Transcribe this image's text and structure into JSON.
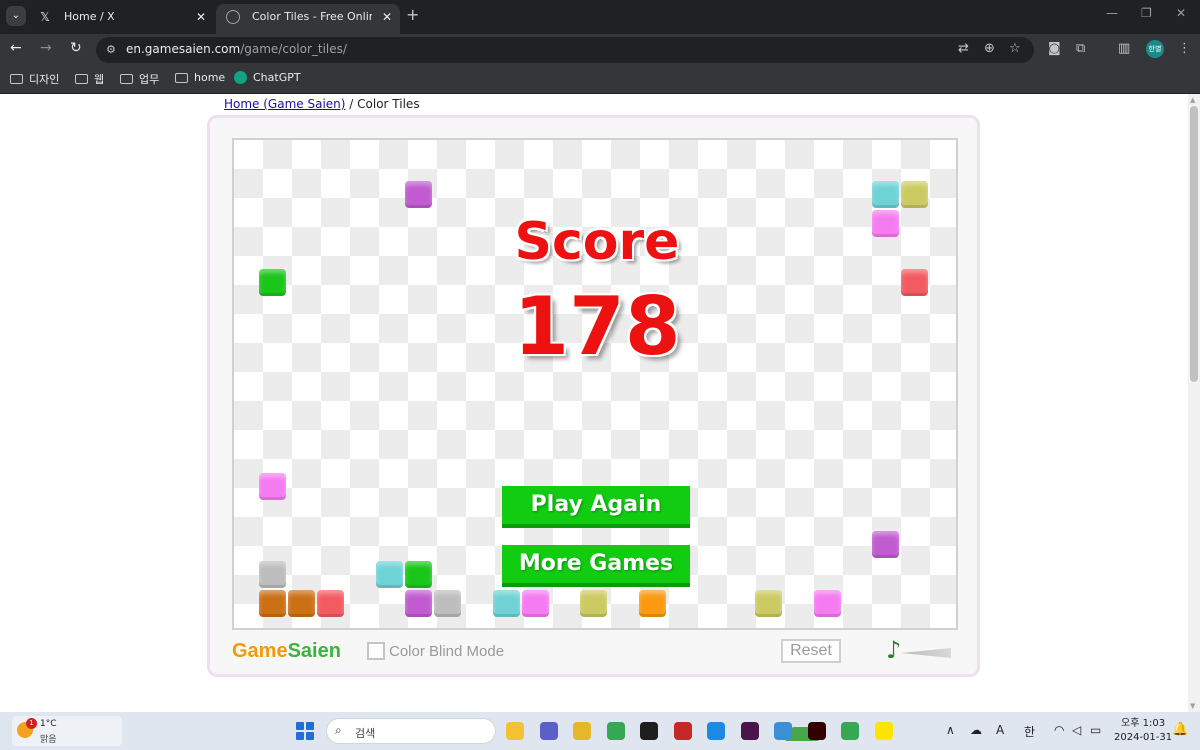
{
  "browser": {
    "tabs": [
      {
        "title": "Home / X",
        "icon": "x-logo-icon",
        "active": false
      },
      {
        "title": "Color Tiles - Free Online Puzzle",
        "icon": "globe-icon",
        "active": true
      }
    ],
    "address": {
      "domain": "en.gamesaien.com",
      "path": "/game/color_tiles/"
    },
    "bookmarks": [
      {
        "label": "디자인",
        "icon": "folder-icon"
      },
      {
        "label": "웹",
        "icon": "folder-icon"
      },
      {
        "label": "업무",
        "icon": "folder-icon"
      },
      {
        "label": "home",
        "icon": "folder-icon"
      },
      {
        "label": "ChatGPT",
        "icon": "chatgpt-icon"
      }
    ],
    "profile_label": "한별"
  },
  "page": {
    "breadcrumb": {
      "home_link": "Home (Game Saien)",
      "separator": "/",
      "current": "Color Tiles"
    },
    "game": {
      "score_label": "Score",
      "score_value": "178",
      "buttons": {
        "play_again": "Play Again",
        "more_games": "More Games"
      },
      "logo": {
        "part1": "Game",
        "part2": "Saien"
      },
      "color_blind_label": "Color Blind Mode",
      "reset_label": "Reset",
      "colors": {
        "purple": "#c05cd0",
        "cyan": "#6fd3d6",
        "olive": "#cccb63",
        "pink": "#f57cf0",
        "green": "#1bc61b",
        "red": "#f25c60",
        "gray": "#bdbdbd",
        "orange": "#fb9a10",
        "brown": "#cb7014"
      },
      "tiles": [
        {
          "col": 6,
          "row": 1,
          "color": "purple"
        },
        {
          "col": 22,
          "row": 1,
          "color": "cyan"
        },
        {
          "col": 23,
          "row": 1,
          "color": "olive"
        },
        {
          "col": 22,
          "row": 2,
          "color": "pink"
        },
        {
          "col": 1,
          "row": 4,
          "color": "green"
        },
        {
          "col": 23,
          "row": 4,
          "color": "red"
        },
        {
          "col": 1,
          "row": 11,
          "color": "pink"
        },
        {
          "col": 22,
          "row": 13,
          "color": "purple"
        },
        {
          "col": 1,
          "row": 14,
          "color": "gray"
        },
        {
          "col": 5,
          "row": 14,
          "color": "cyan"
        },
        {
          "col": 6,
          "row": 14,
          "color": "green"
        },
        {
          "col": 1,
          "row": 15,
          "color": "brown"
        },
        {
          "col": 2,
          "row": 15,
          "color": "brown"
        },
        {
          "col": 3,
          "row": 15,
          "color": "red"
        },
        {
          "col": 6,
          "row": 15,
          "color": "purple"
        },
        {
          "col": 7,
          "row": 15,
          "color": "gray"
        },
        {
          "col": 9,
          "row": 15,
          "color": "cyan"
        },
        {
          "col": 10,
          "row": 15,
          "color": "pink"
        },
        {
          "col": 12,
          "row": 15,
          "color": "olive"
        },
        {
          "col": 14,
          "row": 15,
          "color": "orange"
        },
        {
          "col": 18,
          "row": 15,
          "color": "olive"
        },
        {
          "col": 20,
          "row": 15,
          "color": "pink"
        }
      ]
    }
  },
  "taskbar": {
    "weather": {
      "temp": "1°C",
      "condition": "맑음",
      "badge": "1"
    },
    "search_placeholder": "검색",
    "apps": [
      {
        "name": "file-explorer-app",
        "color": "#f3c233"
      },
      {
        "name": "chat-app",
        "color": "#5b5fc7"
      },
      {
        "name": "folder-app",
        "color": "#e8b62a"
      },
      {
        "name": "chrome-app",
        "color": "#34a853"
      },
      {
        "name": "figma-app",
        "color": "#1e1e1e"
      },
      {
        "name": "snipping-app",
        "color": "#c62828"
      },
      {
        "name": "paint-app",
        "color": "#1e88e5"
      },
      {
        "name": "slack-app",
        "color": "#4a154b"
      },
      {
        "name": "notepad-app",
        "color": "#3a8fd6"
      },
      {
        "name": "illustrator-app",
        "color": "#330000"
      },
      {
        "name": "chrome-profile-app",
        "color": "#34a853"
      },
      {
        "name": "kakaotalk-app",
        "color": "#fee500"
      }
    ],
    "ime": "한",
    "time": "오후 1:03",
    "date": "2024-01-31"
  }
}
